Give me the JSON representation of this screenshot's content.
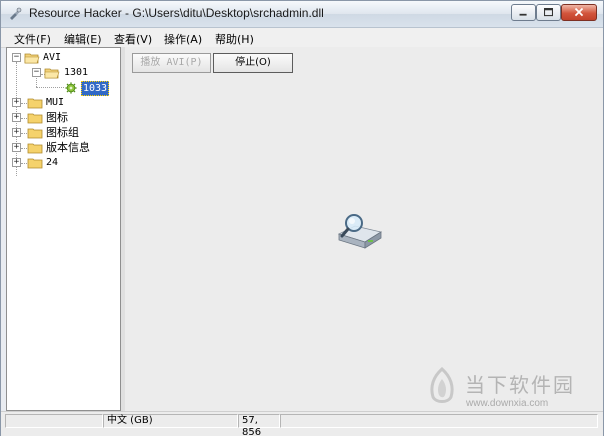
{
  "window": {
    "app_name": "Resource Hacker",
    "separator": " - ",
    "file_path": "G:\\Users\\ditu\\Desktop\\srchadmin.dll"
  },
  "menu": [
    "文件(F)",
    "编辑(E)",
    "查看(V)",
    "操作(A)",
    "帮助(H)"
  ],
  "tree": {
    "avi": "AVI",
    "avi_child": "1301",
    "avi_leaf": "1033",
    "others": [
      "MUI",
      "图标",
      "图标组",
      "版本信息",
      "24"
    ]
  },
  "toolbar": {
    "play_label": "播放 AVI(P)",
    "stop_label": "停止(O)"
  },
  "status": {
    "cell0": "",
    "cell1": "中文 (GB)",
    "cell2": "57, 856",
    "cell3": ""
  },
  "watermark": {
    "brand": "当下软件园",
    "url": "www.downxia.com"
  },
  "colors": {
    "selection": "#3169c6",
    "close_button": "#c2412a",
    "title_gradient_top": "#f6f9fc"
  },
  "icons": {
    "app": "resource-hacker-icon",
    "folder": "folder-icon",
    "leaf": "gear-icon",
    "animation": "disk-search-icon"
  }
}
